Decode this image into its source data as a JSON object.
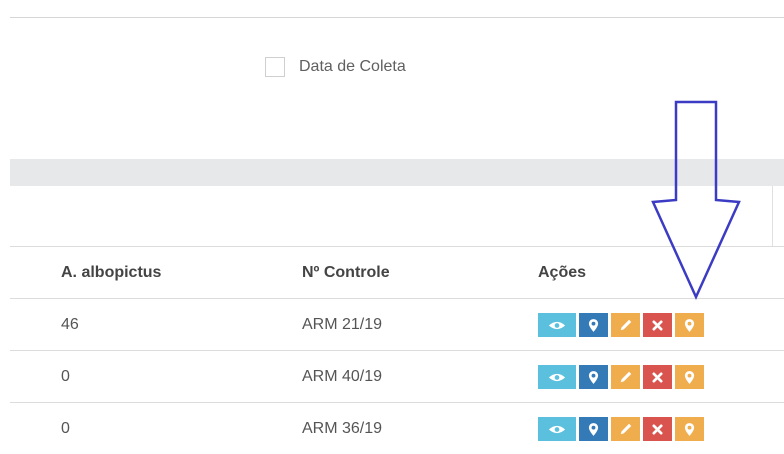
{
  "filters": {
    "date_label": "Data de Coleta"
  },
  "table": {
    "columns": [
      "A. albopictus",
      "Nº Controle",
      "Ações"
    ],
    "rows": [
      {
        "albopictus": "46",
        "controle": "ARM 21/19"
      },
      {
        "albopictus": "0",
        "controle": "ARM 40/19"
      },
      {
        "albopictus": "0",
        "controle": "ARM 36/19"
      }
    ]
  },
  "icons": {
    "view": "eye-icon",
    "location": "map-marker-icon",
    "edit": "pencil-icon",
    "delete": "close-icon",
    "georef": "map-marker-icon"
  },
  "colors": {
    "view": "#5bc0de",
    "location": "#337ab7",
    "edit": "#f0ad4e",
    "delete": "#d9534f",
    "georef": "#f0ad4e",
    "annotation_arrow": "#3b3bc4"
  }
}
